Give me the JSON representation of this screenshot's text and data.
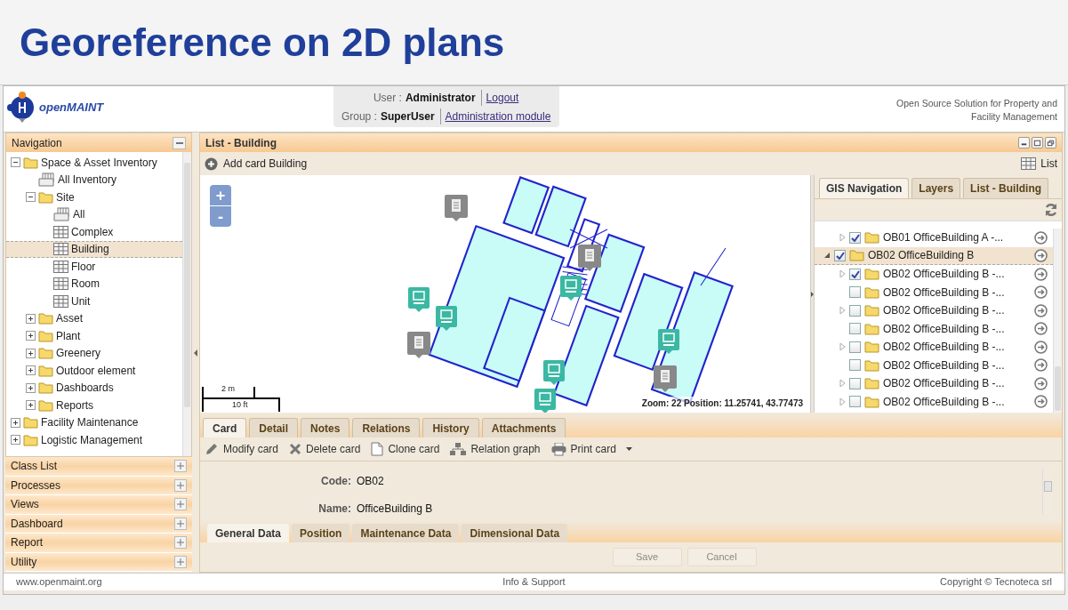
{
  "slide_title": "Georeference on 2D plans",
  "header": {
    "logo": "open**MAINT**",
    "user_label": "User :",
    "user": "Administrator",
    "logout": "Logout",
    "group_label": "Group :",
    "group": "SuperUser",
    "admin_link": "Administration module",
    "tagline": "Open Source Solution for Property and Facility Management"
  },
  "navigation": {
    "title": "Navigation",
    "tree": [
      {
        "label": "Space & Asset Inventory",
        "kind": "folder",
        "expanded": true,
        "selected": false,
        "children": [
          {
            "label": "All Inventory",
            "kind": "view",
            "selected": false
          },
          {
            "label": "Site",
            "kind": "folder",
            "expanded": true,
            "selected": false,
            "children": [
              {
                "label": "All",
                "kind": "view",
                "selected": false
              },
              {
                "label": "Complex",
                "kind": "class",
                "selected": false
              },
              {
                "label": "Building",
                "kind": "class",
                "selected": true
              },
              {
                "label": "Floor",
                "kind": "class",
                "selected": false
              },
              {
                "label": "Room",
                "kind": "class",
                "selected": false
              },
              {
                "label": "Unit",
                "kind": "class",
                "selected": false
              }
            ]
          },
          {
            "label": "Asset",
            "kind": "folder",
            "expanded": false,
            "selected": false
          },
          {
            "label": "Plant",
            "kind": "folder",
            "expanded": false,
            "selected": false
          },
          {
            "label": "Greenery",
            "kind": "folder",
            "expanded": false,
            "selected": false
          },
          {
            "label": "Outdoor element",
            "kind": "folder",
            "expanded": false,
            "selected": false
          },
          {
            "label": "Dashboards",
            "kind": "folder",
            "expanded": false,
            "selected": false
          },
          {
            "label": "Reports",
            "kind": "folder",
            "expanded": false,
            "selected": false
          }
        ]
      },
      {
        "label": "Facility Maintenance",
        "kind": "folder",
        "expanded": false,
        "selected": false
      },
      {
        "label": "Logistic Management",
        "kind": "folder",
        "expanded": false,
        "selected": false
      }
    ]
  },
  "accordion": [
    {
      "label": "Class List"
    },
    {
      "label": "Processes"
    },
    {
      "label": "Views"
    },
    {
      "label": "Dashboard"
    },
    {
      "label": "Report"
    },
    {
      "label": "Utility"
    }
  ],
  "main": {
    "title": "List - Building",
    "add_button": "Add card Building",
    "list_button": "List"
  },
  "map": {
    "zoom_in": "+",
    "zoom_out": "-",
    "scale_metric": "2 m",
    "scale_imperial": "10 ft",
    "status": "Zoom: 22 Position: 11.25741, 43.77473"
  },
  "gis_panel": {
    "tabs": [
      {
        "label": "GIS Navigation",
        "selected": true
      },
      {
        "label": "Layers",
        "selected": false
      },
      {
        "label": "List - Building",
        "selected": false
      }
    ],
    "tree": [
      {
        "label": "OB01 OfficeBuilding A -...",
        "checked": true,
        "expanded": false,
        "selected": false
      },
      {
        "label": "OB02 OfficeBuilding B",
        "checked": true,
        "expanded": true,
        "selected": true,
        "children": [
          {
            "label": "OB02 OfficeBuilding B -...",
            "checked": true,
            "expanded": false,
            "selected": false
          },
          {
            "label": "OB02 OfficeBuilding B -...",
            "checked": false,
            "leaf": true,
            "selected": false
          },
          {
            "label": "OB02 OfficeBuilding B -...",
            "checked": false,
            "expanded": false,
            "selected": false
          },
          {
            "label": "OB02 OfficeBuilding B -...",
            "checked": false,
            "leaf": true,
            "selected": false
          },
          {
            "label": "OB02 OfficeBuilding B -...",
            "checked": false,
            "expanded": false,
            "selected": false
          },
          {
            "label": "OB02 OfficeBuilding B -...",
            "checked": false,
            "leaf": true,
            "selected": false
          },
          {
            "label": "OB02 OfficeBuilding B -...",
            "checked": false,
            "expanded": false,
            "selected": false
          },
          {
            "label": "OB02 OfficeBuilding B -...",
            "checked": false,
            "expanded": false,
            "selected": false
          }
        ]
      }
    ]
  },
  "card_tabs": [
    {
      "label": "Card",
      "selected": true
    },
    {
      "label": "Detail",
      "selected": false
    },
    {
      "label": "Notes",
      "selected": false
    },
    {
      "label": "Relations",
      "selected": false
    },
    {
      "label": "History",
      "selected": false
    },
    {
      "label": "Attachments",
      "selected": false
    }
  ],
  "card_toolbar": [
    {
      "label": "Modify card",
      "kind": "edit"
    },
    {
      "label": "Delete card",
      "kind": "delete"
    },
    {
      "label": "Clone card",
      "kind": "clone"
    },
    {
      "label": "Relation graph",
      "kind": "graph"
    },
    {
      "label": "Print card",
      "kind": "print"
    }
  ],
  "card_fields": [
    {
      "label": "Code:",
      "value": "OB02"
    },
    {
      "label": "Name:",
      "value": "OfficeBuilding B"
    }
  ],
  "card_subtabs": [
    {
      "label": "General Data",
      "selected": true
    },
    {
      "label": "Position",
      "selected": false
    },
    {
      "label": "Maintenance Data",
      "selected": false
    },
    {
      "label": "Dimensional Data",
      "selected": false
    }
  ],
  "form_buttons": [
    {
      "label": "Save",
      "disabled": true
    },
    {
      "label": "Cancel",
      "disabled": true
    }
  ],
  "footer": {
    "left": "www.openmaint.org",
    "center": "Info & Support",
    "right": "Copyright © Tecnoteca srl"
  }
}
